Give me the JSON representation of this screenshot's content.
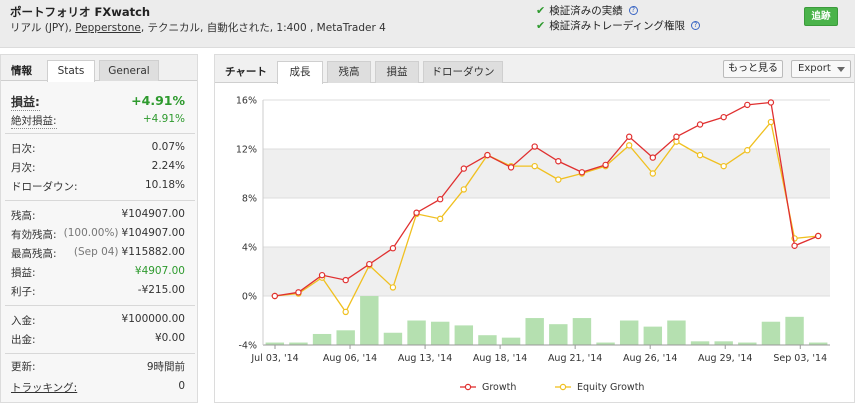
{
  "header": {
    "title": "ポートフォリオ  FXwatch",
    "subtitle_prefix": "リアル (JPY), ",
    "subtitle_link": "Pepperstone",
    "subtitle_suffix": ", テクニカル, 自動化された, 1:400 , MetaTrader 4",
    "verified_track": "検証済みの実績",
    "verified_trading": "検証済みトレーディング権限",
    "follow_label": "追跡"
  },
  "left_panel": {
    "section_label": "情報",
    "tabs": [
      {
        "label": "Stats",
        "active": true
      },
      {
        "label": "General",
        "active": false
      }
    ],
    "gain": {
      "label": "損益:",
      "value": "+4.91%"
    },
    "abs_gain": {
      "label": "絶対損益:",
      "value": "+4.91%"
    },
    "daily": {
      "label": "日次:",
      "value": "0.07%"
    },
    "monthly": {
      "label": "月次:",
      "value": "2.24%"
    },
    "drawdown": {
      "label": "ドローダウン:",
      "value": "10.18%"
    },
    "balance": {
      "label": "残高:",
      "value": "¥104907.00"
    },
    "equity": {
      "label": "有効残高:",
      "pct": "(100.00%)",
      "value": "¥104907.00"
    },
    "highest": {
      "label": "最高残高:",
      "date": "(Sep 04)",
      "value": "¥115882.00"
    },
    "profit": {
      "label": "損益:",
      "value": "¥4907.00"
    },
    "interest": {
      "label": "利子:",
      "value": "-¥215.00"
    },
    "deposits": {
      "label": "入金:",
      "value": "¥100000.00"
    },
    "withdrawals": {
      "label": "出金:",
      "value": "¥0.00"
    },
    "updated": {
      "label": "更新:",
      "value": "9時間前"
    },
    "tracking": {
      "label": "トラッキング:",
      "value": "0"
    }
  },
  "right_panel": {
    "section_label": "チャート",
    "tabs": [
      {
        "label": "成長",
        "active": true
      },
      {
        "label": "残高",
        "active": false
      },
      {
        "label": "損益",
        "active": false
      },
      {
        "label": "ドローダウン",
        "active": false
      }
    ],
    "more_label": "もっと見る",
    "export_label": "Export"
  },
  "chart_data": {
    "type": "line",
    "ylim": [
      -4,
      16
    ],
    "y_ticks": [
      "16%",
      "12%",
      "8%",
      "4%",
      "0%",
      "-4%"
    ],
    "x_ticks": [
      "Jul 03, '14",
      "Aug 06, '14",
      "Aug 13, '14",
      "Aug 18, '14",
      "Aug 21, '14",
      "Aug 26, '14",
      "Aug 29, '14",
      "Sep 03, '14"
    ],
    "series": [
      {
        "name": "Growth",
        "color": "#e03030",
        "values": [
          0.0,
          0.3,
          1.7,
          1.3,
          2.6,
          3.9,
          6.8,
          7.9,
          10.4,
          11.5,
          10.5,
          12.2,
          11.0,
          10.1,
          10.7,
          13.0,
          11.3,
          13.0,
          14.0,
          14.6,
          15.6,
          15.8,
          4.1,
          4.9
        ]
      },
      {
        "name": "Equity Growth",
        "color": "#f0c020",
        "values": [
          0.0,
          0.2,
          1.5,
          -1.3,
          2.5,
          0.7,
          6.7,
          6.3,
          8.7,
          11.5,
          10.6,
          10.6,
          9.5,
          10.0,
          10.6,
          12.3,
          10.0,
          12.6,
          11.5,
          10.6,
          11.9,
          14.2,
          4.7,
          4.9
        ]
      }
    ],
    "bars": [
      0.2,
      0.2,
      0.9,
      1.2,
      4.0,
      1.0,
      2.0,
      1.9,
      1.6,
      0.8,
      0.6,
      2.2,
      1.7,
      2.2,
      0.2,
      2.0,
      1.5,
      2.0,
      0.3,
      0.3,
      0.2,
      1.9,
      2.3,
      0.2
    ],
    "bar_color": "#b5e0b0",
    "legend_position": "bottom"
  }
}
